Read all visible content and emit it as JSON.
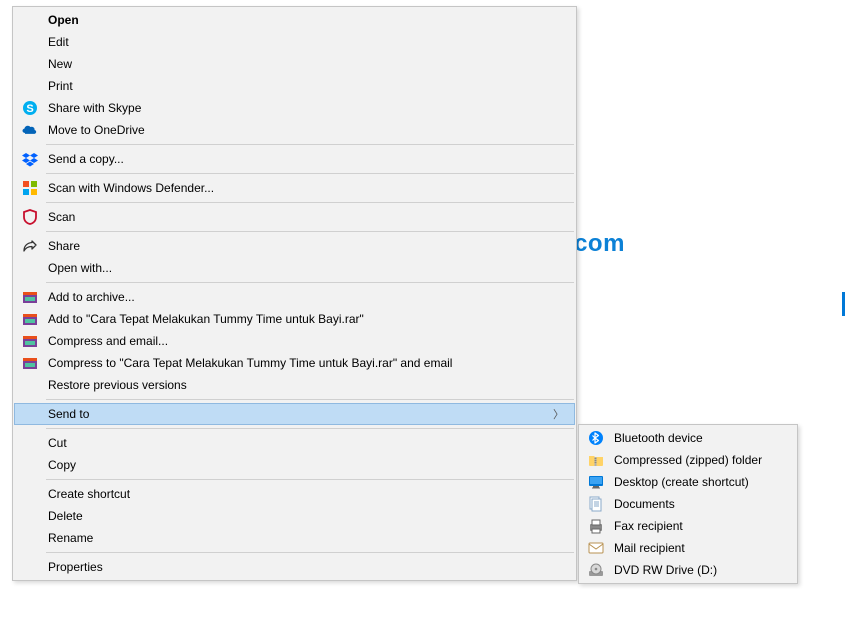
{
  "watermark": "Masbilly.com",
  "main_menu": {
    "open": "Open",
    "edit": "Edit",
    "new": "New",
    "print": "Print",
    "share_skype": "Share with Skype",
    "move_onedrive": "Move to OneDrive",
    "send_copy": "Send a copy...",
    "scan_defender": "Scan with Windows Defender...",
    "scan": "Scan",
    "share": "Share",
    "open_with": "Open with...",
    "add_archive": "Add to archive...",
    "add_to_rar": "Add to \"Cara Tepat Melakukan Tummy Time untuk Bayi.rar\"",
    "compress_email": "Compress and email...",
    "compress_to_email": "Compress to \"Cara Tepat Melakukan Tummy Time untuk Bayi.rar\" and email",
    "restore_prev": "Restore previous versions",
    "send_to": "Send to",
    "cut": "Cut",
    "copy": "Copy",
    "create_shortcut": "Create shortcut",
    "delete": "Delete",
    "rename": "Rename",
    "properties": "Properties"
  },
  "submenu": {
    "bluetooth": "Bluetooth device",
    "compressed": "Compressed (zipped) folder",
    "desktop": "Desktop (create shortcut)",
    "documents": "Documents",
    "fax": "Fax recipient",
    "mail": "Mail recipient",
    "dvd": "DVD RW Drive (D:)"
  }
}
